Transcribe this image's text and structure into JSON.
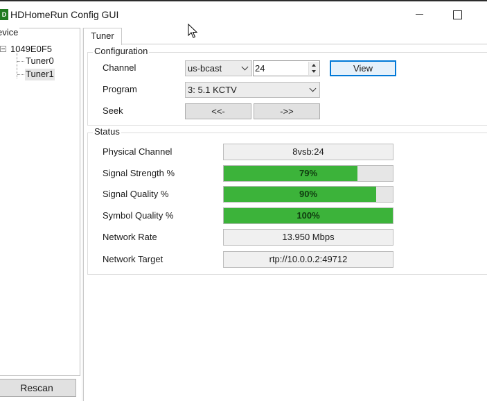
{
  "window": {
    "icon_text": "D",
    "title": "HDHomeRun Config GUI"
  },
  "sidebar": {
    "group_label": "evice",
    "device_id": "1049E0F5",
    "tuners": [
      "Tuner0",
      "Tuner1"
    ],
    "selected_tuner": "Tuner1",
    "rescan_label": "Rescan"
  },
  "tabs": [
    {
      "label": "Tuner",
      "selected": true
    }
  ],
  "configuration": {
    "legend": "Configuration",
    "channel_label": "Channel",
    "channel_map": "us-bcast",
    "channel_number": "24",
    "view_label": "View",
    "program_label": "Program",
    "program_value": "3: 5.1 KCTV",
    "seek_label": "Seek",
    "seek_back_label": "<<-",
    "seek_forward_label": "->>"
  },
  "status": {
    "legend": "Status",
    "physical_channel_label": "Physical Channel",
    "physical_channel_value": "8vsb:24",
    "signal_strength_label": "Signal Strength %",
    "signal_strength_text": "79%",
    "signal_strength_fraction": 0.79,
    "signal_quality_label": "Signal Quality %",
    "signal_quality_text": "90%",
    "signal_quality_fraction": 0.9,
    "symbol_quality_label": "Symbol Quality %",
    "symbol_quality_text": "100%",
    "symbol_quality_fraction": 1.0,
    "network_rate_label": "Network Rate",
    "network_rate_value": "13.950 Mbps",
    "network_target_label": "Network Target",
    "network_target_value": "rtp://10.0.0.2:49712"
  },
  "colors": {
    "bar_fill": "#3cb33a",
    "focus_border": "#0078d7"
  },
  "icons": {
    "app": "hdhomerun-app-icon",
    "minimize": "minimize-icon",
    "maximize": "maximize-icon",
    "expander": "tree-collapse-icon",
    "pointer": "mouse-pointer-icon"
  }
}
